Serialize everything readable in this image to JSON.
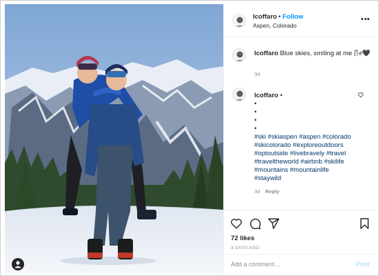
{
  "post": {
    "username": "lcoffaro",
    "follow_label": "Follow",
    "separator": "•",
    "location": "Aspen, Colorado",
    "image_description": "Two skiers in blue jackets, one on the other's back, on a snowy summit with mountains behind"
  },
  "caption": {
    "username": "lcoffaro",
    "text": "Blue skies, smiling at me 🌬🖤",
    "time": "3d"
  },
  "hashtag_comment": {
    "username": "lcoffaro",
    "dot": "•",
    "bullets": [
      "•",
      "•",
      "•",
      "•"
    ],
    "hashtag_lines": [
      "#ski #skiaspen #aspen #colorado",
      "#skicolorado #exploreoutdoors",
      "#optoutside #livebravely #travel",
      "#traveltheworld #airbnb #skilife",
      "#mountains #mountainlife",
      "#staywild"
    ],
    "time": "3d",
    "reply_label": "Reply"
  },
  "actions": {
    "likes": "72 likes",
    "posted_ago": "3 DAYS AGO"
  },
  "comment_box": {
    "placeholder": "Add a comment…",
    "post_label": "Post"
  },
  "icons": {
    "like": "heart-icon",
    "comment": "comment-bubble-icon",
    "share": "paper-plane-icon",
    "save": "bookmark-icon",
    "more": "more-options-icon",
    "tag": "user-tag-icon"
  },
  "colors": {
    "link_blue": "#0095f6",
    "hashtag": "#00376b",
    "muted": "#8e8e8e",
    "post_disabled": "#b2dffc"
  }
}
